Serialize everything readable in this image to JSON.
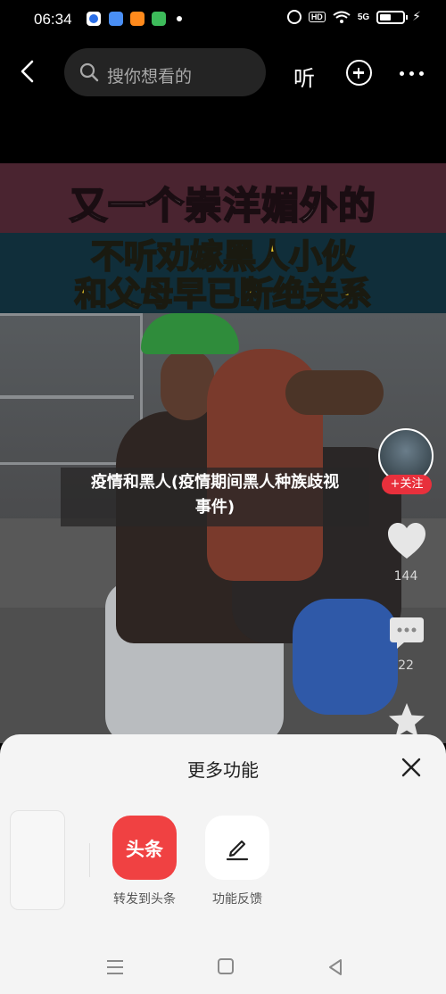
{
  "status_bar": {
    "time": "06:34",
    "hd": "HD",
    "signal": "5G",
    "charging_glyph": "⚡"
  },
  "top_nav": {
    "search_placeholder": "搜你想看的",
    "listen_label": "听"
  },
  "video": {
    "caption_line_1": "又一个崇洋媚外的",
    "caption_line_2a": "不听劝嫁黑人小伙",
    "caption_line_2b": "和父母早已断绝关系",
    "title_line_1": "疫情和黑人(疫情期间黑人种族歧视",
    "title_line_2": "事件)",
    "follow_label": "+关注",
    "like_count": "144",
    "comment_count": "22"
  },
  "sheet": {
    "title": "更多功能",
    "actions": [
      {
        "tile_text": "头条",
        "label": "转发到头条",
        "icon": "toutiao-logo"
      },
      {
        "tile_text": "",
        "label": "功能反馈",
        "icon": "edit-icon"
      }
    ]
  },
  "colors": {
    "toutiao_red": "#f04142",
    "follow_red": "#e8303c",
    "caption_yellow": "#f3cf2c"
  }
}
